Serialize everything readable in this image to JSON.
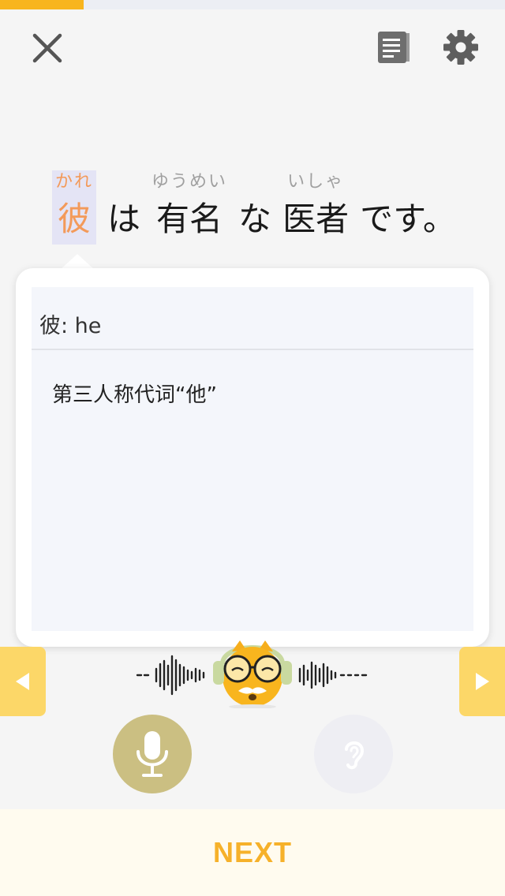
{
  "progress": {
    "fraction": 0.166,
    "color": "#f8b51e"
  },
  "header": {
    "close_icon": "close-icon",
    "book_icon": "book-icon",
    "settings_icon": "gear-icon"
  },
  "sentence": {
    "words": [
      {
        "furigana": "かれ",
        "text": "彼",
        "selected": true
      },
      {
        "furigana": "",
        "text": "は"
      },
      {
        "furigana": "ゆうめい",
        "text": "有名"
      },
      {
        "furigana": "",
        "text": "な"
      },
      {
        "furigana": "いしゃ",
        "text": "医者"
      },
      {
        "furigana": "",
        "text": "です。"
      }
    ]
  },
  "popup": {
    "title": "彼: he",
    "definition": "第三人称代词“他”"
  },
  "controls": {
    "prev_icon": "triangle-left-icon",
    "next_icon": "triangle-right-icon",
    "mic_icon": "microphone-icon",
    "listen_icon": "ear-icon",
    "mascot": "mascot-with-headphones"
  },
  "footer": {
    "next_label": "NEXT"
  },
  "colors": {
    "accent": "#f8b51e",
    "highlight_text": "#f39a5a",
    "mic_button": "#cbbf82",
    "side_buttons": "#fcd768"
  }
}
